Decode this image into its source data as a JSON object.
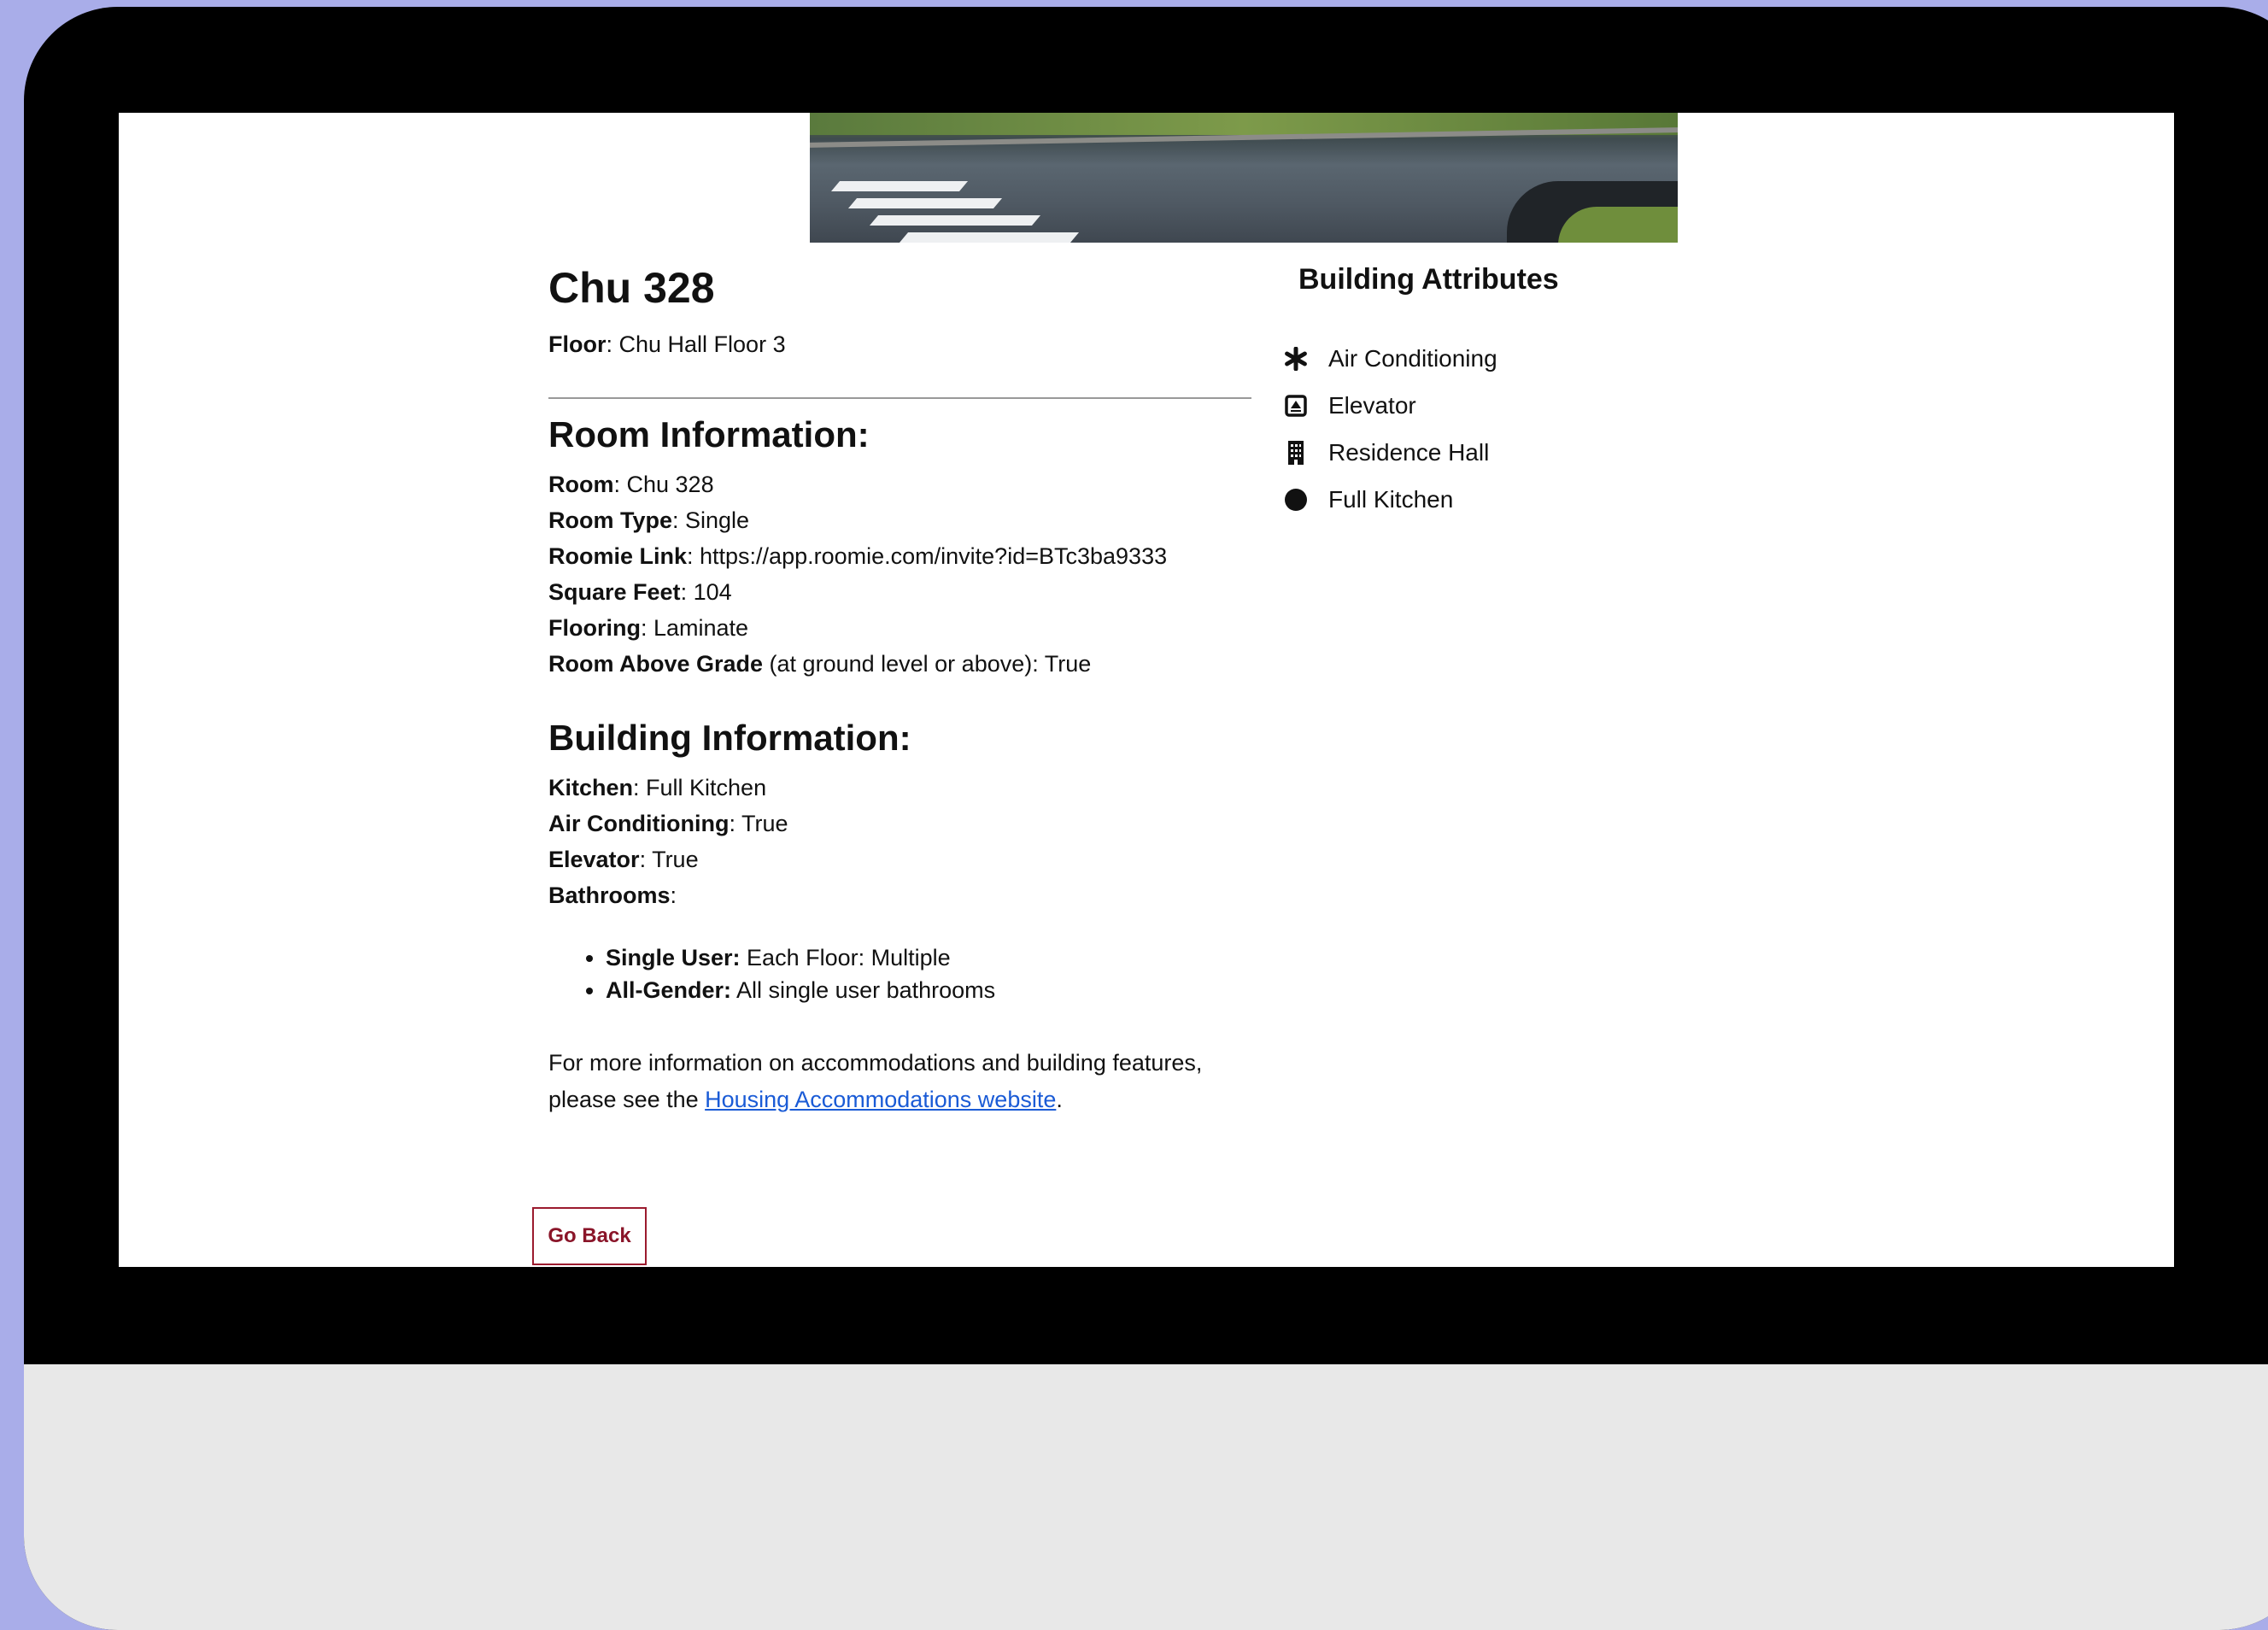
{
  "room": {
    "title": "Chu 328",
    "floor_label": "Floor",
    "floor_value": ": Chu Hall Floor 3"
  },
  "room_info": {
    "heading": "Room Information:",
    "rows": [
      {
        "label": "Room",
        "value": ": Chu 328"
      },
      {
        "label": "Room Type",
        "value": ": Single"
      },
      {
        "label": "Roomie Link",
        "value": ": https://app.roomie.com/invite?id=BTc3ba9333"
      },
      {
        "label": "Square Feet",
        "value": ": 104"
      },
      {
        "label": "Flooring",
        "value": ": Laminate"
      },
      {
        "label": "Room Above Grade",
        "value": " (at ground level or above): True"
      }
    ]
  },
  "building_info": {
    "heading": "Building Information:",
    "rows": [
      {
        "label": "Kitchen",
        "value": ": Full Kitchen"
      },
      {
        "label": "Air Conditioning",
        "value": ": True"
      },
      {
        "label": "Elevator",
        "value": ": True"
      },
      {
        "label": "Bathrooms",
        "value": ":"
      }
    ],
    "bathrooms": [
      {
        "label": "Single User:",
        "value": " Each Floor: Multiple"
      },
      {
        "label": "All-Gender:",
        "value": " All single user bathrooms"
      }
    ]
  },
  "footer_text": {
    "before_link": "For more information on accommodations and building features, please see the ",
    "link": "Housing Accommodations website",
    "after_link": "."
  },
  "go_back_label": "Go Back",
  "attributes": {
    "heading": "Building Attributes",
    "items": [
      {
        "icon": "asterisk-icon",
        "label": "Air Conditioning"
      },
      {
        "icon": "elevator-icon",
        "label": "Elevator"
      },
      {
        "icon": "building-icon",
        "label": "Residence Hall"
      },
      {
        "icon": "circle-icon",
        "label": "Full Kitchen"
      }
    ]
  },
  "colors": {
    "background": "#a9ade9",
    "link": "#1a5bd6",
    "button_accent": "#9b1b2e"
  }
}
